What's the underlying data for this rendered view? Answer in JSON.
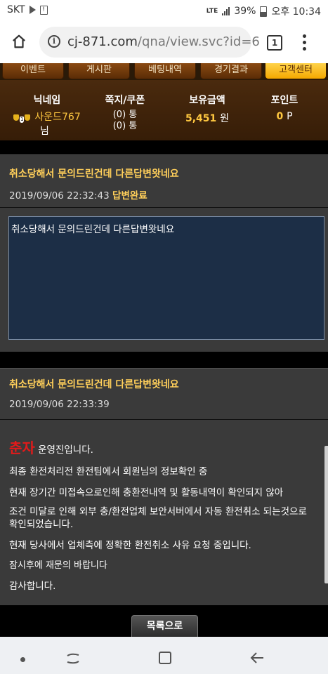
{
  "status": {
    "carrier": "SKT",
    "network": "LTE",
    "battery": "39%",
    "time": "오후 10:34"
  },
  "browser": {
    "url_host": "cj-871.com",
    "url_path": "/qna/view.svc?id=6",
    "tab_count": "1"
  },
  "nav": [
    "이벤트",
    "게시판",
    "베팅내역",
    "경기결과",
    "고객센터"
  ],
  "account": {
    "nickname_label": "닉네임",
    "nickname_value": "사운드767",
    "nickname_suffix": "님",
    "msg_label": "쪽지/쿠폰",
    "msg_value": "(0) 통",
    "coupon_value": "(0) 통",
    "balance_label": "보유금액",
    "balance_value": "5,451",
    "balance_unit": "원",
    "points_label": "포인트",
    "points_value": "0",
    "points_unit": "P",
    "level_badge": "1"
  },
  "question": {
    "title": "취소당해서 문의드린건데 다른답변왓네요",
    "date": "2019/09/06 22:32:43",
    "status": "답변완료",
    "body": "취소당해서 문의드린건데 다른답변왓네요"
  },
  "answer": {
    "title": "취소당해서 문의드린건데 다른답변왓네요",
    "date": "2019/09/06 22:33:39",
    "brand": "춘자",
    "intro": " 운영진입니다.",
    "lines": [
      "최종 환전처리전 환전팀에서 회원님의 정보확인 중",
      "현재 장기간 미접속으로인해 충환전내역 및 활동내역이 확인되지 않아",
      "조건 미달로 인해 외부 충/환전업체 보안서버에서 자동 환전취소 되는것으로 확인되었습니다.",
      "현재 당사에서 업체측에 정확한 환전취소 사유 요청 중입니다."
    ],
    "red_line": "잠시후에 재문의 바랍니다",
    "closing": "감사합니다."
  },
  "list_button": "목록으로",
  "colors": {
    "accent": "#ffcf5a",
    "red": "#e21a1a",
    "panel": "#3a3a3a",
    "question_box": "#1c2e46"
  }
}
